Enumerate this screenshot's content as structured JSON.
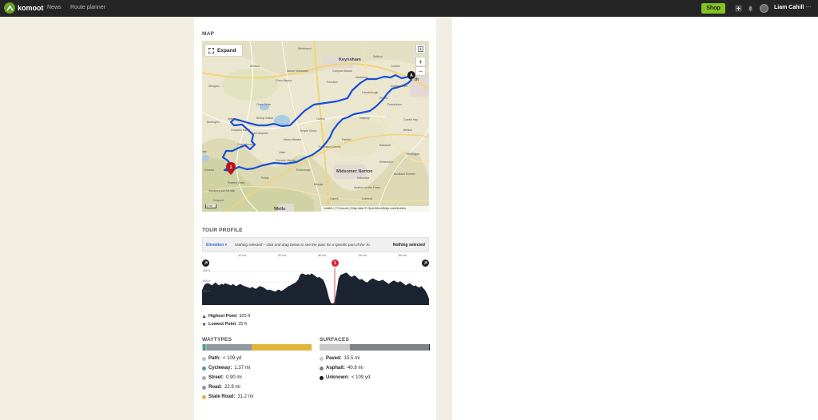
{
  "app": {
    "name": "komoot"
  },
  "nav": {
    "news": "News",
    "route_planner": "Route planner"
  },
  "header": {
    "shop": "Shop",
    "user_name": "Liam Cahill",
    "more": "···"
  },
  "map": {
    "title": "MAP",
    "expand": "Expand",
    "zoom_in": "+",
    "zoom_out": "−",
    "attribution": "Leaflet | © Komoot | Map data © OpenStreetMap contributors",
    "scale": "2 mi",
    "start_marker": "A",
    "waypoint_marker": "1",
    "places": {
      "keynsham": "Keynsham",
      "midsomer_norton": "Midsomer Norton",
      "wells": "Wells",
      "bath_fragment": "th",
      "blagdon_fragment": "dge",
      "compton_dando": "Compton Dando",
      "chew_magna": "Chew Magna",
      "chew_stoke": "Chew Stoke",
      "clutton": "Clutton",
      "peasedown": "Peasedown",
      "radstock": "Radstock",
      "temple_cloud": "Temple Cloud",
      "chewton_mendip": "Chewton Mendip",
      "pensford": "Pensford",
      "priddy": "Priddy",
      "stratton": "Stratton-on-the-Fosse",
      "buckland": "Buckland Dinham",
      "rodney_stoke": "Rodney Stoke",
      "westbury": "Westbury-sub-Mendip",
      "combe_hay": "Combe Hay",
      "englishcombe": "Englishcombe",
      "wellow": "Wellow",
      "paulton": "Paulton",
      "hinton_blewett": "Hinton Blewett",
      "farmborough": "Farmborough",
      "timsbury": "Timsbury",
      "burrington": "Burrington",
      "charterhouse": "Charterhouse",
      "hemington": "Hemington",
      "litton": "Litton",
      "harptree": "East Harptree",
      "ubley": "Ubley",
      "compton_martin": "Compton Martin",
      "binegar": "Binegar",
      "oakhill": "Oakhill",
      "coleford": "Coleford",
      "kilmersdon": "Kilmersdon",
      "holcombe": "Holcombe",
      "dundry": "Dundry",
      "whitchurch": "Whitchurch",
      "saltford": "Saltford",
      "corston": "Corston",
      "marksbury": "Marksbury",
      "priston": "Priston",
      "norton_malreward": "Norton Malreward",
      "bishop_sutton": "Bishop Sutton",
      "winford": "Winford",
      "wrington": "Wrington",
      "cheddar": "Cheddar",
      "draycott": "Draycott",
      "emborough": "Emborough",
      "farrington": "Farrington Gurney"
    }
  },
  "profile": {
    "title": "TOUR PROFILE",
    "elevation_label": "Elevation ▾",
    "hint": "Nothing selected – click and drag below to see the stats for a specific part of the To",
    "nothing_selected": "Nothing selected",
    "distance_ticks": [
      "10 mi",
      "20 mi",
      "30 mi",
      "40 mi",
      "50 mi"
    ],
    "elevation_ticks": [
      "900 ft",
      "600 ft",
      "300 ft"
    ],
    "highest_label": "Highest Point",
    "highest_value": "925 ft",
    "lowest_label": "Lowest Point",
    "lowest_value": "25 ft",
    "waypoint_marker": "1",
    "elevation_samples": [
      420,
      560,
      610,
      620,
      600,
      560,
      600,
      640,
      590,
      560,
      610,
      580,
      620,
      600,
      580,
      560,
      600,
      560,
      540,
      580,
      600,
      560,
      540,
      520,
      500,
      480,
      520,
      480,
      460,
      500,
      540,
      520,
      500,
      460,
      420,
      440,
      420,
      400,
      380,
      420,
      440,
      400,
      420,
      460,
      500,
      540,
      560,
      600,
      620,
      660,
      720,
      860,
      900,
      880,
      860,
      880,
      860,
      900,
      860,
      820,
      780,
      800,
      760,
      720,
      600,
      420,
      200,
      60,
      40,
      100,
      420,
      760,
      860,
      880,
      900,
      925,
      880,
      820,
      800,
      840,
      820,
      760,
      720,
      740,
      700,
      660,
      640,
      700,
      740,
      760,
      720,
      700,
      680,
      700,
      720,
      680,
      640,
      600,
      640,
      680,
      700,
      660,
      640,
      680,
      640,
      600,
      560,
      600,
      620,
      580,
      540,
      560,
      520,
      500,
      540,
      480,
      420,
      320,
      180
    ]
  },
  "waytypes": {
    "title": "WAYTYPES",
    "items": [
      {
        "label": "Path:",
        "value": "< 109 yd",
        "color": "#b8c4c0",
        "share": 0.4
      },
      {
        "label": "Cycleway:",
        "value": "1.37 mi",
        "color": "#4aa37a",
        "share": 2.5
      },
      {
        "label": "Street:",
        "value": "0.90 mi",
        "color": "#a7aeb2",
        "share": 1.6
      },
      {
        "label": "Road:",
        "value": "22.9 mi",
        "color": "#9199a0",
        "share": 40.6
      },
      {
        "label": "State Road:",
        "value": "31.2 mi",
        "color": "#e2b53c",
        "share": 55.3
      }
    ]
  },
  "surfaces": {
    "title": "SURFACES",
    "items": [
      {
        "label": "Paved:",
        "value": "15.5 mi",
        "color": "#c9c9c9",
        "share": 27.5
      },
      {
        "label": "Asphalt:",
        "value": "40.8 mi",
        "color": "#7f8287",
        "share": 72.3
      },
      {
        "label": "Unknown:",
        "value": "< 109 yd",
        "color": "#1a1a1a",
        "share": 0.2
      }
    ]
  }
}
